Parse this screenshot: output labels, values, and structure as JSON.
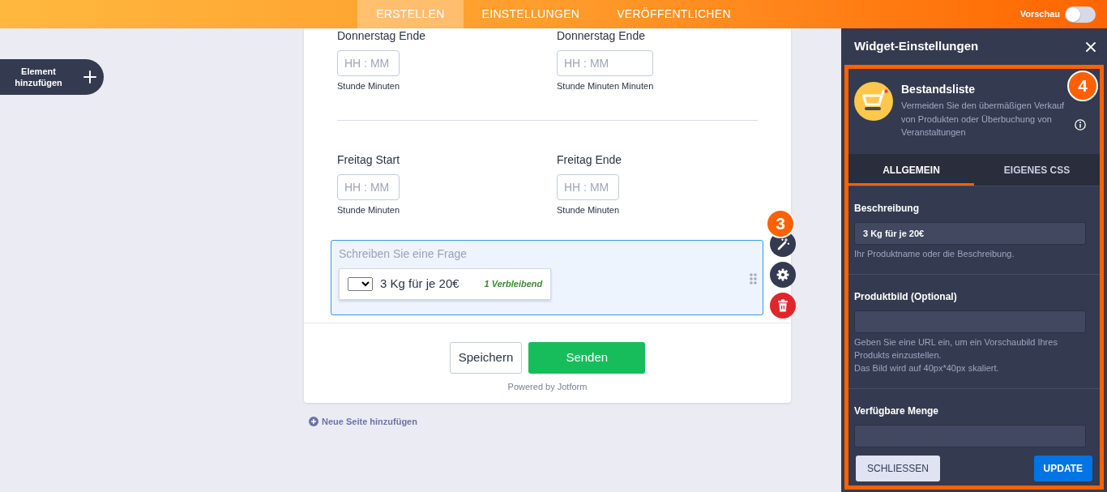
{
  "top_bar": {
    "tabs": [
      {
        "label": "ERSTELLEN",
        "selected": true
      },
      {
        "label": "EINSTELLUNGEN",
        "selected": false
      },
      {
        "label": "VERÖFFENTLICHEN",
        "selected": false
      }
    ],
    "preview": {
      "label": "Vorschau",
      "on": false
    }
  },
  "add_element": {
    "label": "Element hinzufügen"
  },
  "form": {
    "time_rows": [
      {
        "fields": [
          {
            "label": "Donnerstag Ende",
            "placeholder": "HH : MM",
            "sublabel": "Stunde Minuten"
          },
          {
            "label": "Donnerstag Ende",
            "placeholder": "HH : MM",
            "sublabel": "Stunde Minuten Minuten"
          }
        ]
      },
      {
        "fields": [
          {
            "label": "Freitag Start",
            "placeholder": "HH : MM",
            "sublabel": "Stunde Minuten"
          },
          {
            "label": "Freitag Ende",
            "placeholder": "HH : MM",
            "sublabel": "Stunde Minuten"
          }
        ]
      }
    ],
    "question": {
      "placeholder": "Schreiben Sie eine Frage",
      "selected": true,
      "step_badge": "3",
      "product": {
        "name": "3 Kg für je 20€",
        "remaining": "1 Verbleibend"
      }
    },
    "buttons": [
      {
        "label": "Speichern",
        "kind": "secondary"
      },
      {
        "label": "Senden",
        "kind": "primary"
      }
    ],
    "powered_by": "Powered by Jotform"
  },
  "add_page": {
    "label": "Neue Seite hinzufügen"
  },
  "panel": {
    "title": "Widget-Einstellungen",
    "highlighted": true,
    "step_badge": "4",
    "widget": {
      "name": "Bestandsliste",
      "description": "Vermeiden Sie den übermäßigen Verkauf von Produkten oder Überbuchung von Veranstaltungen"
    },
    "tabs": [
      {
        "label": "ALLGEMEIN",
        "selected": true
      },
      {
        "label": "EIGENES CSS",
        "selected": false
      }
    ],
    "fields": [
      {
        "label": "Beschreibung",
        "value": "3 Kg für je 20€",
        "help": [
          "Ihr Produktname oder die Beschreibung."
        ]
      },
      {
        "label": "Produktbild (Optional)",
        "help": [
          "Geben Sie eine URL ein, um ein Vorschaubild Ihres Produkts einzustellen.",
          "Das Bild wird auf 40px*40px skaliert."
        ]
      },
      {
        "label": "Verfügbare Menge"
      }
    ],
    "buttons": [
      {
        "label": "SCHLIESSEN",
        "kind": "secondary"
      },
      {
        "label": "UPDATE",
        "kind": "primary"
      }
    ]
  }
}
